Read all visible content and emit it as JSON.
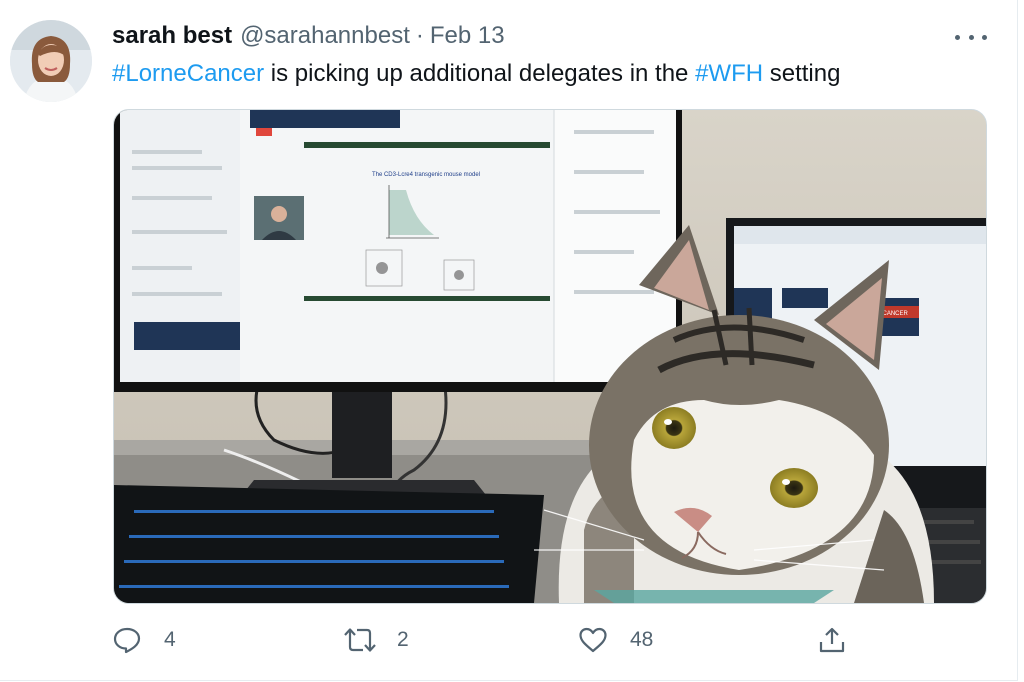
{
  "tweet": {
    "author_name": "sarah best",
    "handle": "@sarahannbest",
    "separator": "·",
    "date": "Feb 13",
    "text_parts": [
      {
        "text": "#LorneCancer",
        "hashtag": true
      },
      {
        "text": " is picking up additional delegates in the ",
        "hashtag": false
      },
      {
        "text": "#WFH",
        "hashtag": true
      },
      {
        "text": " setting",
        "hashtag": false
      }
    ]
  },
  "media": {
    "slide_title": "The CD3-Lcre4 transgenic mouse model",
    "banner_text": "LORNE CANCER"
  },
  "actions": {
    "reply_count": "4",
    "retweet_count": "2",
    "like_count": "48"
  },
  "icons": [
    "avatar-photo",
    "more-dots-icon",
    "reply-icon",
    "retweet-icon",
    "like-icon",
    "share-icon"
  ],
  "colors": {
    "hashtag": "#1d9bf0",
    "secondary_text": "#536471",
    "primary_text": "#0f1419"
  }
}
